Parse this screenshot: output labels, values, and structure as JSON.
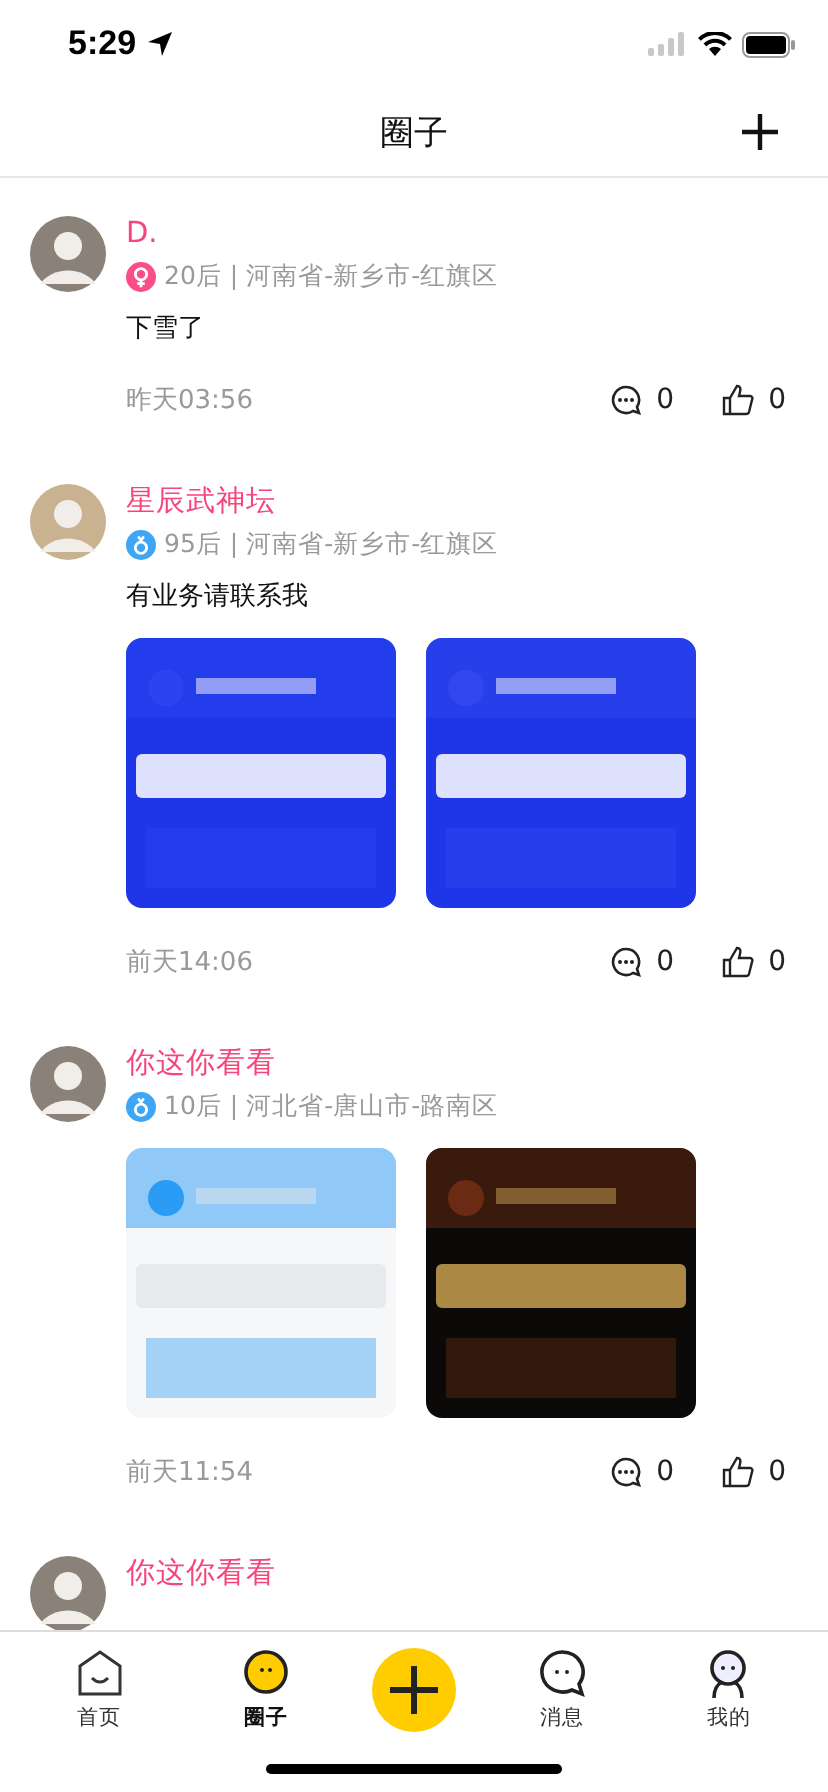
{
  "status_bar": {
    "time": "5:29"
  },
  "header": {
    "title": "圈子"
  },
  "posts": [
    {
      "name": "D.",
      "badge": {
        "kind": "female",
        "color": "#fb4e87"
      },
      "meta": "20后 | 河南省-新乡市-红旗区",
      "text": "下雪了",
      "time": "昨天03:56",
      "comments": "0",
      "likes": "0"
    },
    {
      "name": "星辰武神坛",
      "badge": {
        "kind": "male",
        "color": "#3ea6f5"
      },
      "meta": "95后 | 河南省-新乡市-红旗区",
      "text": "有业务请联系我",
      "time": "前天14:06",
      "comments": "0",
      "likes": "0"
    },
    {
      "name": "你这你看看",
      "badge": {
        "kind": "male",
        "color": "#3ea6f5"
      },
      "meta": "10后 | 河北省-唐山市-路南区",
      "time": "前天11:54",
      "comments": "0",
      "likes": "0"
    },
    {
      "name": "你这你看看"
    }
  ],
  "tab_bar": [
    {
      "kind": "tab",
      "label": "首页",
      "selected": false
    },
    {
      "kind": "tab",
      "label": "圈子",
      "selected": true
    },
    {
      "kind": "add"
    },
    {
      "kind": "tab",
      "label": "消息",
      "selected": false
    },
    {
      "kind": "tab",
      "label": "我的",
      "selected": false
    }
  ]
}
